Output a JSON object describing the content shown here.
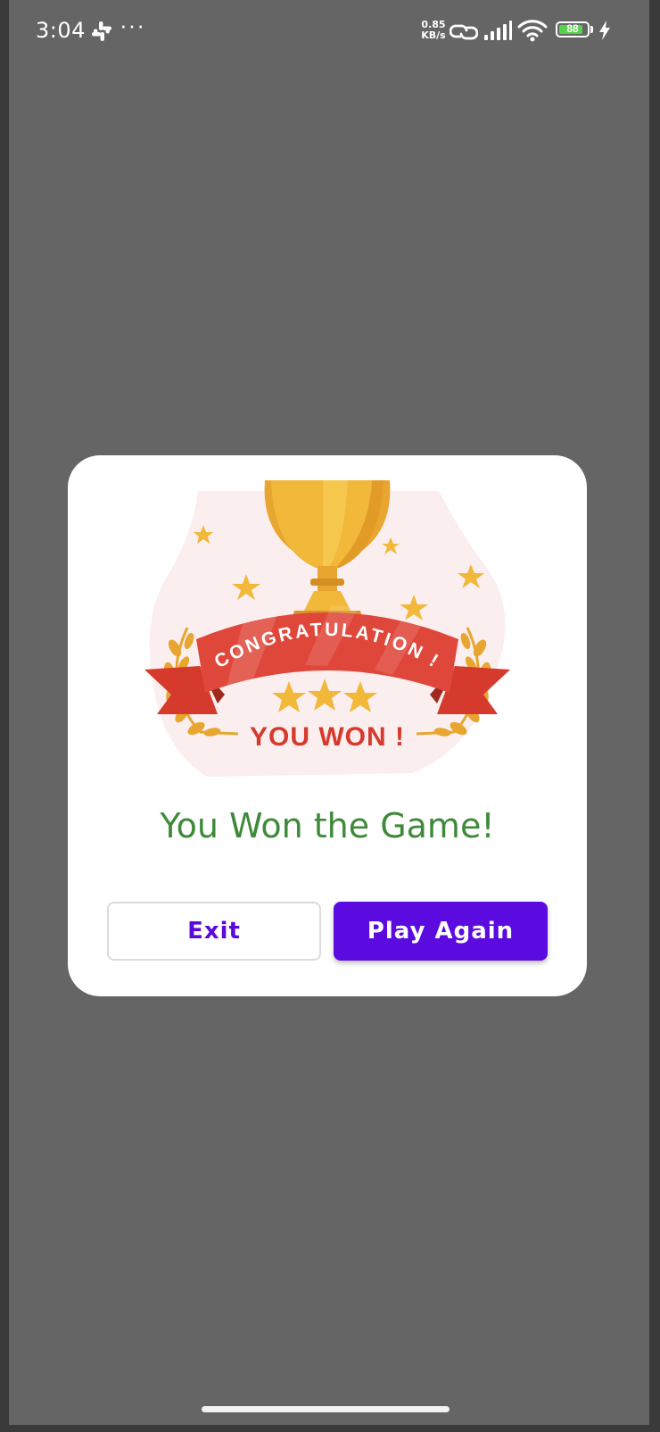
{
  "status_bar": {
    "time": "3:04",
    "icons": [
      "slack-icon",
      "more-dots-icon",
      "network-speed",
      "link-icon",
      "signal-icon",
      "wifi-icon",
      "battery-icon",
      "charging-icon"
    ],
    "more_label": "···",
    "speed_value": "0.85",
    "speed_unit": "KB/s",
    "battery_level": "88",
    "battery_fraction": 0.88,
    "battery_color": "#57d24a"
  },
  "dialog": {
    "banner_top": "CONGRATULATION !",
    "banner_bottom": "YOU WON !",
    "title": "You Won the Game!",
    "title_color": "#3f8a3a",
    "exit_label": "Exit",
    "play_again_label": "Play Again",
    "accent_color": "#5b0be0"
  }
}
